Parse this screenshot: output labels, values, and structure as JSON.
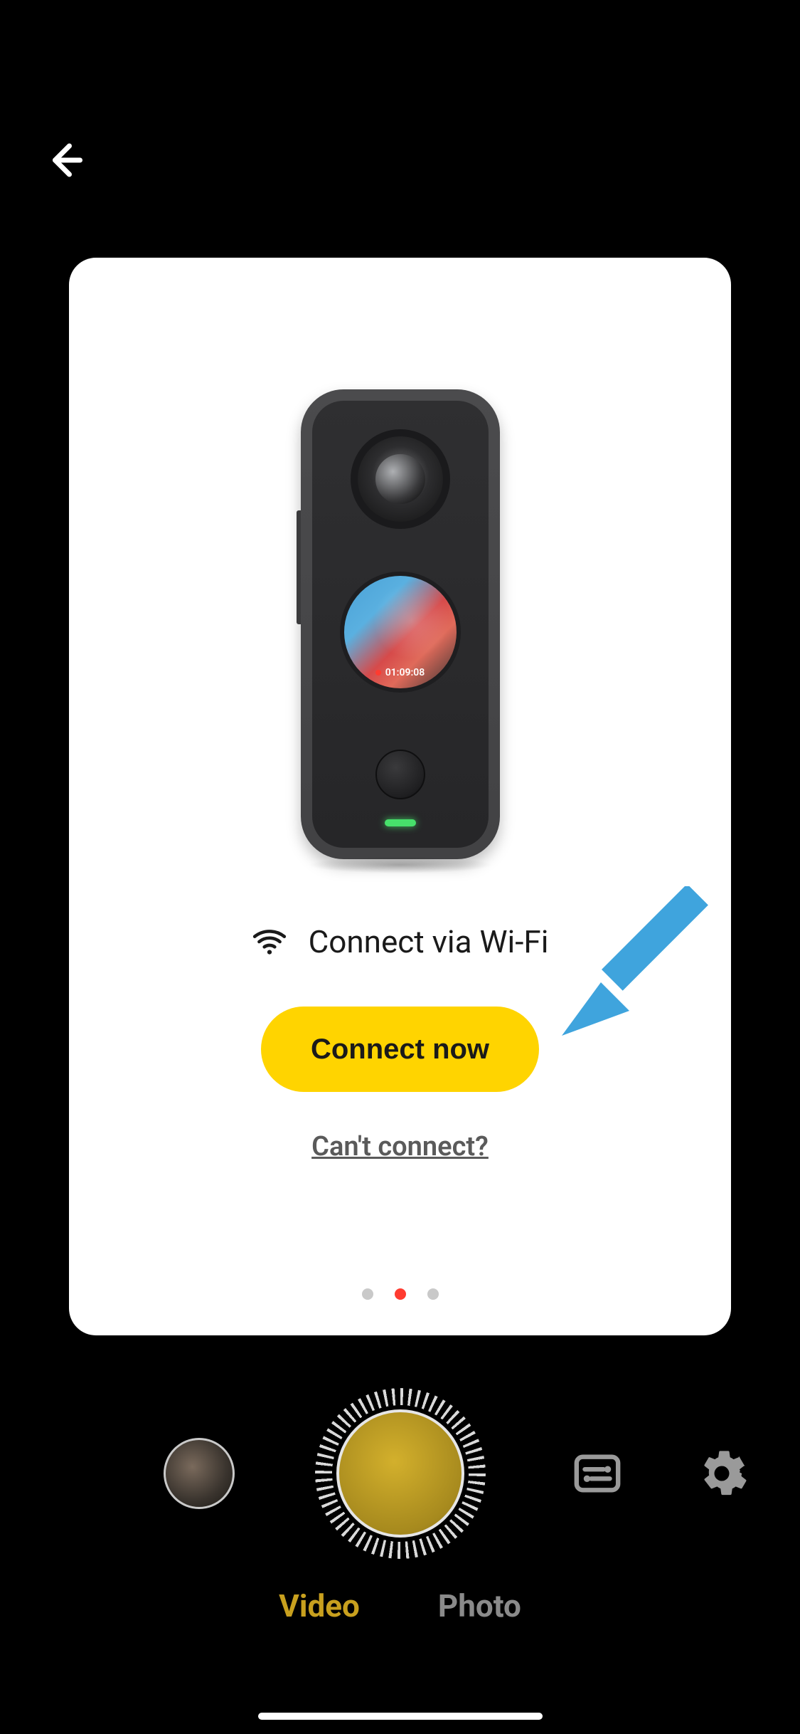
{
  "nav": {
    "back_label": "Back"
  },
  "card": {
    "wifi_label": "Connect via Wi-Fi",
    "connect_button": "Connect now",
    "cant_connect": "Can't connect?",
    "camera_timecode": "01:09:08",
    "page_indicator": {
      "count": 3,
      "active_index": 1
    }
  },
  "controls": {
    "shutter_label": "Shutter",
    "gallery_label": "Gallery",
    "adjust_label": "Adjust",
    "settings_label": "Settings"
  },
  "modes": {
    "items": [
      "Video",
      "Photo"
    ],
    "active": "Video",
    "video": "Video",
    "photo": "Photo"
  },
  "icons": {
    "back": "back-arrow-icon",
    "wifi": "wifi-icon",
    "sliders": "sliders-icon",
    "gear": "gear-icon"
  },
  "annotation": {
    "arrow": "hint-arrow"
  },
  "colors": {
    "accent_yellow": "#ffd400",
    "active_mode": "#c8a01e",
    "dot_active": "#ff3b30"
  }
}
